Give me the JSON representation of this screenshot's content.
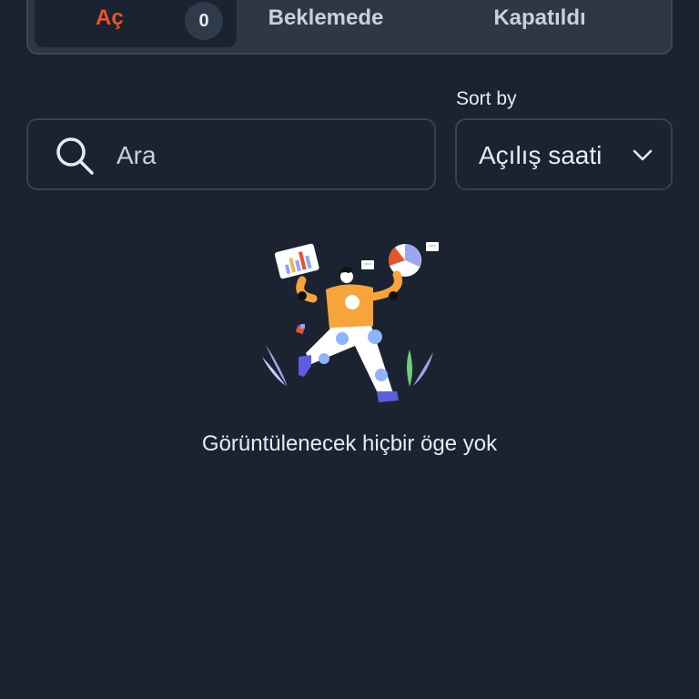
{
  "tabs": {
    "open_label": "Aç",
    "open_count": "0",
    "pending_label": "Beklemede",
    "closed_label": "Kapatıldı"
  },
  "search": {
    "placeholder": "Ara",
    "value": ""
  },
  "sort": {
    "label": "Sort by",
    "selected": "Açılış saati"
  },
  "empty_state": {
    "message": "Görüntülenecek hiçbir öge yok"
  },
  "colors": {
    "background": "#1b2330",
    "accent": "#e8542a",
    "tabbar": "#2d3746"
  }
}
